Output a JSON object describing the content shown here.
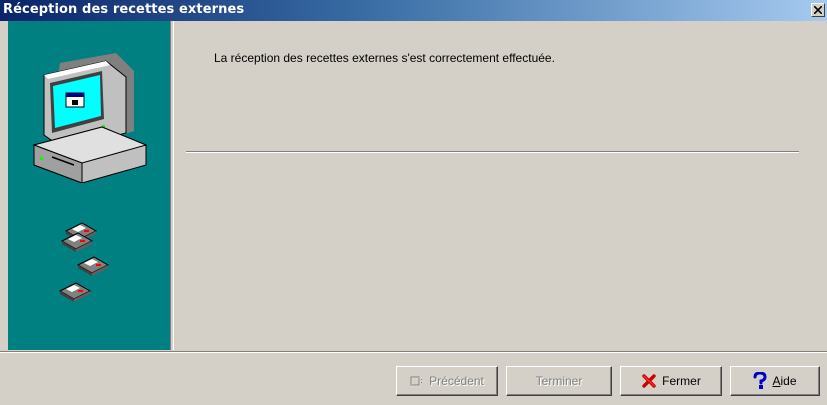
{
  "window": {
    "title": "Réception des recettes externes",
    "close_icon": "close-icon"
  },
  "content": {
    "message": "La réception des recettes externes s'est correctement effectuée."
  },
  "sidebar": {
    "background": "#008080",
    "icons": [
      "computer-icon",
      "floppy-disks-icon"
    ]
  },
  "buttons": {
    "previous": {
      "label": "Précédent",
      "enabled": false,
      "icon": "back-icon"
    },
    "finish": {
      "label": "Terminer",
      "enabled": false
    },
    "close": {
      "label": "Fermer",
      "enabled": true,
      "icon": "red-x-icon"
    },
    "help": {
      "label_prefix": "A",
      "label_rest": "ide",
      "enabled": true,
      "icon": "question-mark-icon"
    }
  }
}
